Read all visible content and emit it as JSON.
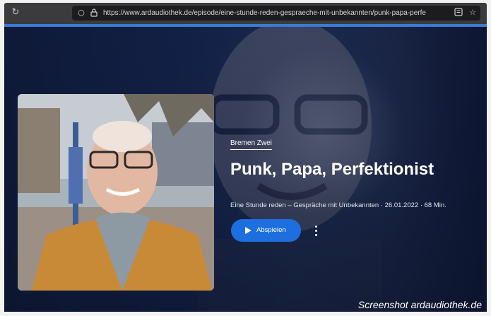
{
  "browser": {
    "url": "https://www.ardaudiothek.de/episode/eine-stunde-reden-gespraeche-mit-unbekannten/punk-papa-perfe",
    "icons": [
      "reload-icon",
      "circle-icon",
      "lock-icon",
      "reader-icon",
      "bookmark-star-icon"
    ]
  },
  "episode": {
    "station": "Bremen Zwei",
    "title": "Punk, Papa, Perfektionist",
    "meta": "Eine Stunde reden – Gespräche mit Unbekannten · 26.01.2022 · 68 Min.",
    "play_label": "Abspielen"
  },
  "caption": "Screenshot ardaudiothek.de",
  "colors": {
    "accent_blue": "#1d6fe0",
    "background_navy": "#14224a"
  }
}
